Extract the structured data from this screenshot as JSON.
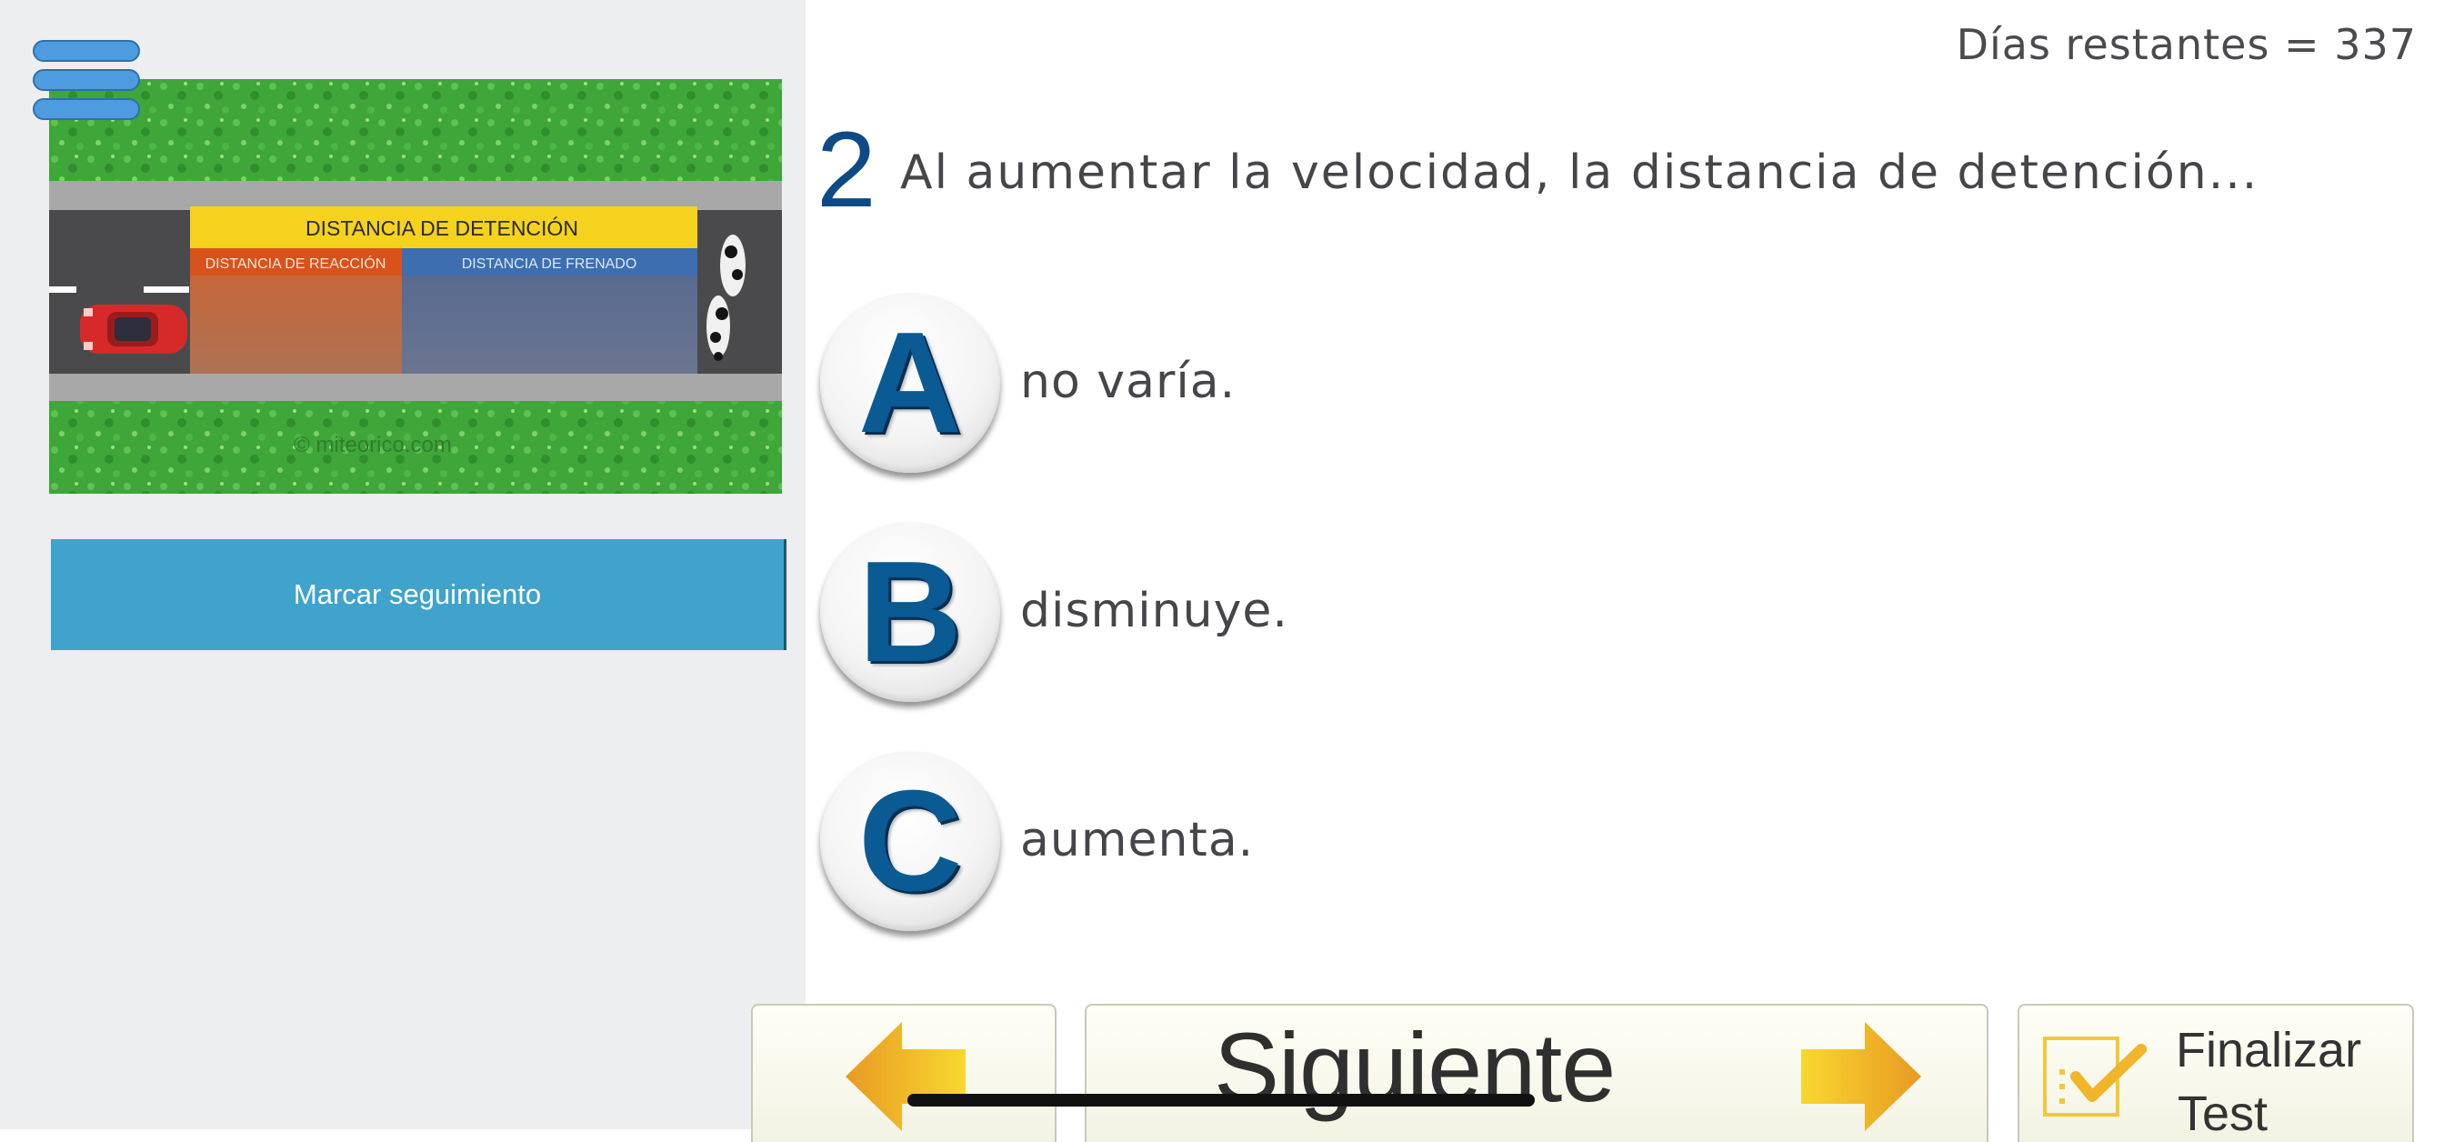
{
  "header": {
    "days_remaining": "Días restantes = 337"
  },
  "sidebar": {
    "menu_icon": "hamburger-menu-icon",
    "illustration": {
      "stopping_label": "DISTANCIA DE DETENCIÓN",
      "reaction_label": "DISTANCIA DE REACCIÓN",
      "braking_label": "DISTANCIA DE FRENADO",
      "watermark": "© miteorico.com"
    },
    "track_button": "Marcar seguimiento"
  },
  "question": {
    "number": "2",
    "text": "Al aumentar la velocidad, la distancia de detención...",
    "options": [
      {
        "letter": "A",
        "text": "no varía."
      },
      {
        "letter": "B",
        "text": "disminuye."
      },
      {
        "letter": "C",
        "text": "aumenta."
      }
    ]
  },
  "footer": {
    "prev_icon": "arrow-left-icon",
    "next_label": "Siguiente",
    "next_icon": "arrow-right-icon",
    "finish_icon": "checklist-icon",
    "finish_label_line1": "Finalizar",
    "finish_label_line2": "Test"
  },
  "colors": {
    "sidebar_bg": "#eceef0",
    "track_button_bg": "#3fa3cc",
    "question_number": "#0e4a86",
    "option_letter": "#0a5a94",
    "arrow_yellow": "#f4c92a"
  }
}
